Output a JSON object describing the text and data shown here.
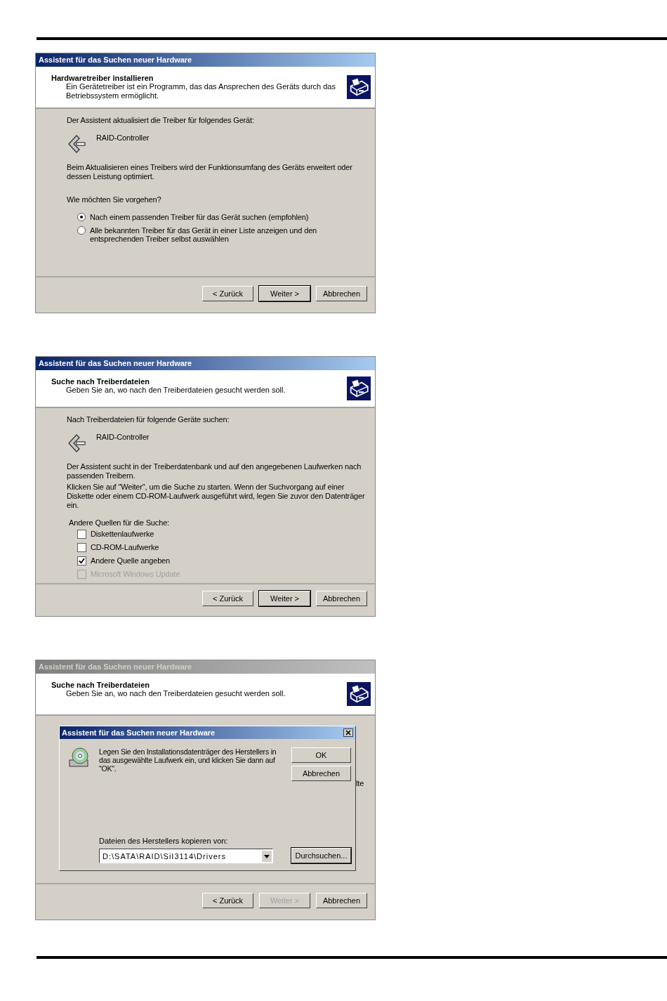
{
  "dialogs": [
    {
      "title": "Assistent für das Suchen neuer Hardware",
      "active": true,
      "header": {
        "title": "Hardwaretreiber installieren",
        "subtitle": "Ein Gerätetreiber ist ein Programm, das das Ansprechen des Geräts durch das Betriebssystem ermöglicht."
      },
      "body": [
        {
          "kind": "text",
          "text": "Der Assistent aktualisiert die Treiber für folgendes Gerät:"
        },
        {
          "kind": "device",
          "text": "RAID-Controller"
        },
        {
          "kind": "text",
          "text": "Beim Aktualisieren eines Treibers wird der Funktionsumfang des Geräts erweitert oder dessen Leistung optimiert."
        },
        {
          "kind": "question",
          "text": "Wie möchten Sie vorgehen?"
        },
        {
          "kind": "radio",
          "text": "Nach einem passenden Treiber für das Gerät suchen (empfohlen)",
          "selected": true
        },
        {
          "kind": "radio",
          "text": "Alle bekannten Treiber für das Gerät in einer Liste anzeigen und den entsprechenden Treiber selbst auswählen",
          "selected": false
        }
      ],
      "buttons": [
        {
          "label": "< Zurück",
          "default": false,
          "disabled": false
        },
        {
          "label": "Weiter >",
          "default": true,
          "disabled": false
        },
        {
          "label": "Abbrechen",
          "default": false,
          "disabled": false
        }
      ]
    },
    {
      "title": "Assistent für das Suchen neuer Hardware",
      "active": true,
      "header": {
        "title": "Suche nach Treiberdateien",
        "subtitle": "Geben Sie an, wo nach den Treiberdateien gesucht werden soll."
      },
      "body": [
        {
          "kind": "text",
          "text": "Nach Treiberdateien für folgende Geräte suchen:"
        },
        {
          "kind": "device",
          "text": "RAID-Controller"
        },
        {
          "kind": "tight",
          "text": "Der Assistent sucht in der Treiberdatenbank und auf den angegebenen Laufwerken nach passenden Treibern."
        },
        {
          "kind": "text",
          "text": "Klicken Sie auf \"Weiter\", um die Suche zu starten. Wenn der Suchvorgang auf einer Diskette oder einem CD-ROM-Laufwerk ausgeführt wird, legen Sie zuvor den Datenträger ein."
        },
        {
          "kind": "label",
          "text": "Andere Quellen für die Suche:"
        },
        {
          "kind": "checkbox",
          "text": "Diskettenlaufwerke",
          "checked": false,
          "disabled": false
        },
        {
          "kind": "checkbox",
          "text": "CD-ROM-Laufwerke",
          "checked": false,
          "disabled": false
        },
        {
          "kind": "checkbox",
          "text": "Andere Quelle angeben",
          "checked": true,
          "disabled": false
        },
        {
          "kind": "checkbox",
          "text": "Microsoft Windows Update",
          "checked": false,
          "disabled": true
        }
      ],
      "buttons": [
        {
          "label": "< Zurück",
          "default": false,
          "disabled": false
        },
        {
          "label": "Weiter >",
          "default": true,
          "disabled": false
        },
        {
          "label": "Abbrechen",
          "default": false,
          "disabled": false
        }
      ]
    },
    {
      "title": "Assistent für das Suchen neuer Hardware",
      "active": false,
      "header": {
        "title": "Suche nach Treiberdateien",
        "subtitle": "Geben Sie an, wo nach den Treiberdateien gesucht werden soll."
      },
      "fragment": "lte",
      "modal": {
        "title": "Assistent für das Suchen neuer Hardware",
        "message": "Legen Sie den Installationsdatenträger des Herstellers in das ausgewählte Laufwerk ein, und klicken Sie dann auf \"OK\".",
        "ok": "OK",
        "cancel": "Abbrechen",
        "path_label": "Dateien des Herstellers kopieren von:",
        "path": "D:\\SATA\\RAID\\SiI3114\\Drivers",
        "browse": "Durchsuchen..."
      },
      "buttons": [
        {
          "label": "< Zurück",
          "default": false,
          "disabled": false
        },
        {
          "label": "Weiter >",
          "default": false,
          "disabled": true
        },
        {
          "label": "Abbrechen",
          "default": false,
          "disabled": false
        }
      ]
    }
  ]
}
